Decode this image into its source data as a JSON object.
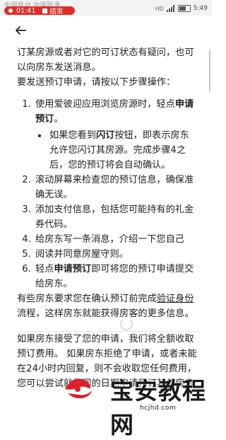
{
  "status_bar": {
    "carrier_text": "中国移动 中国联通",
    "recording_time": "01:41",
    "recording_end": "结束",
    "battery_percent": "5:49",
    "network_tag": "HD"
  },
  "nav": {
    "back_icon": "arrow-left-icon"
  },
  "article": {
    "para1": "订某房源或者对它的可订状态有疑问，也可以向房东发送消息。",
    "para2": "要发送预订申请，请按以下步骤操作：",
    "steps": {
      "s1_pre": "使用爱彼迎应用浏览房源时，轻点",
      "s1_bold": "申请预订",
      "s1_post": "。",
      "s1_sub_pre": "如果您看到",
      "s1_sub_bold": "闪订",
      "s1_sub_post": "按钮，即表示房东允许您闪订其房源。完成步骤4之后，您的预订将会自动确认。",
      "s2": "滚动屏幕来检查您的预订信息，确保准确无误。",
      "s3": "添加支付信息，包括您可能持有的礼金券代码。",
      "s4": "给房东写一条消息，介绍一下您自己",
      "s5": "阅读并同意房屋守则。",
      "s6_pre": "轻点",
      "s6_bold": "申请预订",
      "s6_post": "即可将您的预订申请提交给房东。"
    },
    "para3_pre": "有些房东要求您在确认预订前完成",
    "para3_link": "验证身份",
    "para3_post": "流程，这样房东就能获得房客的更多信息。",
    "para4": "如果房东接受了您的申请，我们将全额收取预订费用。 如果房东拒绝了申请，或者未能在24小时内回复，则不会收取您任何费用，您可以尝试就相同的日期申请预订其他房东"
  },
  "watermark": {
    "title": "宝安教程网",
    "url": "hcjhd.com"
  }
}
